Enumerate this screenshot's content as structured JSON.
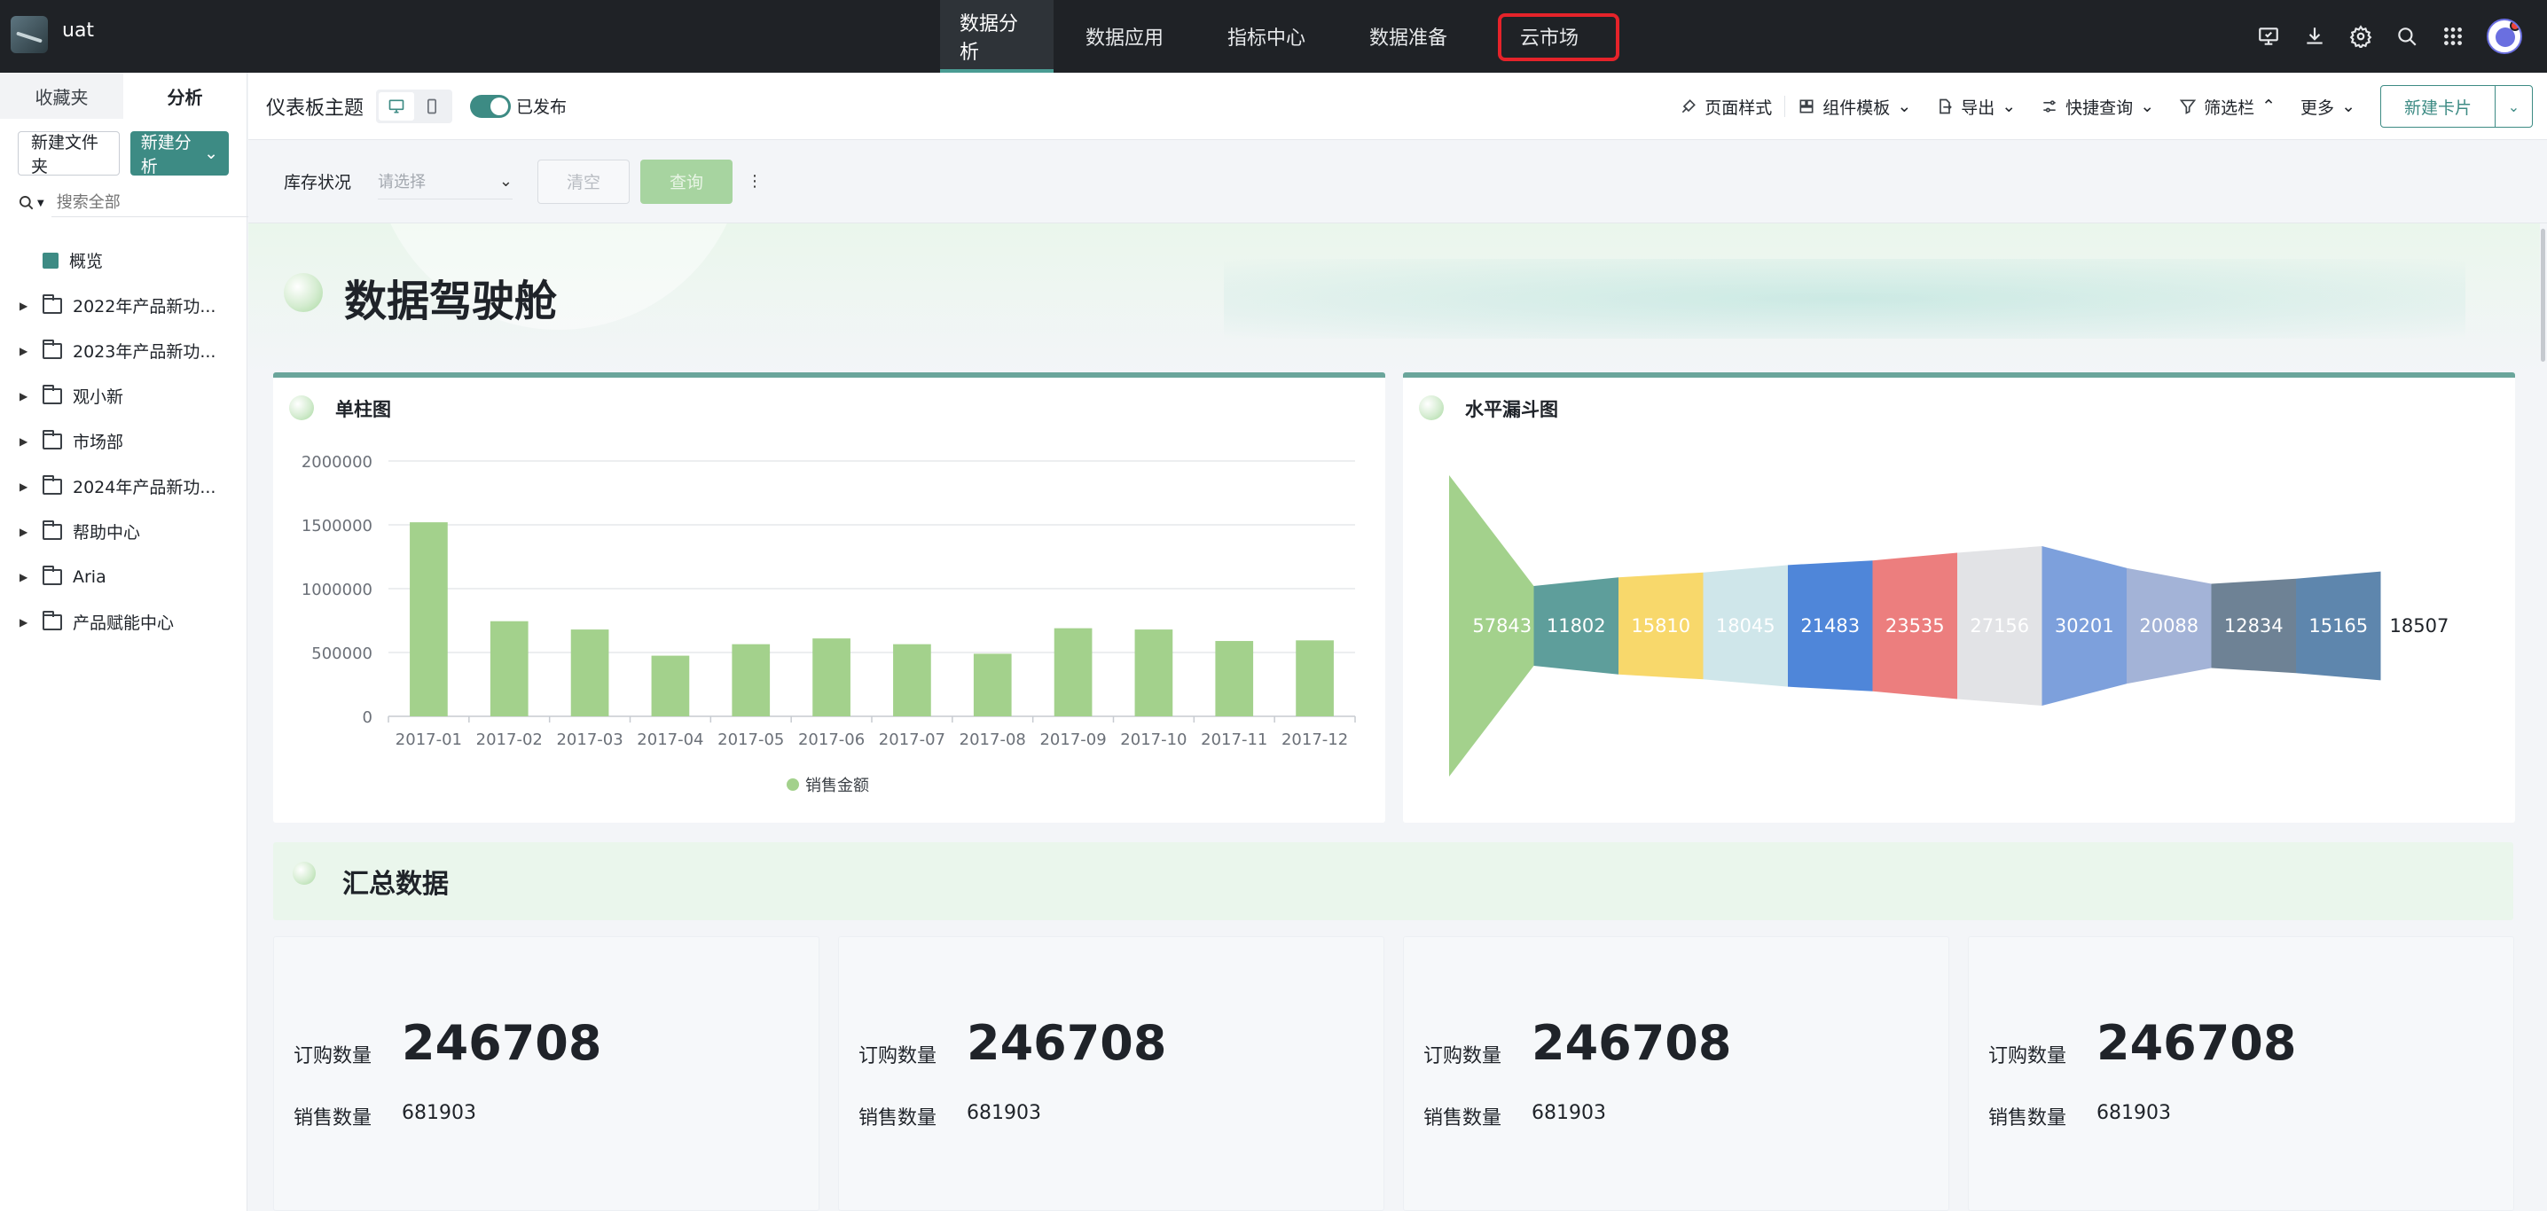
{
  "app": {
    "name": "uat"
  },
  "nav": {
    "items": [
      "数据分析",
      "数据应用",
      "指标中心",
      "数据准备",
      "云市场"
    ],
    "active_index": 0,
    "highlighted_index": 4
  },
  "top_icons": [
    "monitor-icon",
    "download-icon",
    "gear-icon",
    "search-icon",
    "apps-grid-icon",
    "avatar"
  ],
  "sidebar": {
    "tabs": [
      "收藏夹",
      "分析"
    ],
    "active_tab": 1,
    "new_folder_label": "新建文件夹",
    "new_analysis_label": "新建分析",
    "search_placeholder": "搜索全部",
    "items": [
      {
        "label": "概览",
        "type": "chart"
      },
      {
        "label": "2022年产品新功...",
        "type": "folder"
      },
      {
        "label": "2023年产品新功...",
        "type": "folder"
      },
      {
        "label": "观小新",
        "type": "folder"
      },
      {
        "label": "市场部",
        "type": "folder"
      },
      {
        "label": "2024年产品新功...",
        "type": "folder"
      },
      {
        "label": "帮助中心",
        "type": "folder"
      },
      {
        "label": "Aria",
        "type": "folder"
      },
      {
        "label": "产品赋能中心",
        "type": "folder"
      }
    ]
  },
  "toolbar": {
    "title": "仪表板主题",
    "published_label": "已发布",
    "actions": [
      "页面样式",
      "组件模板",
      "导出",
      "快捷查询",
      "筛选栏",
      "更多"
    ],
    "new_card_label": "新建卡片"
  },
  "filter": {
    "label": "库存状况",
    "select_placeholder": "请选择",
    "clear_label": "清空",
    "query_label": "查询"
  },
  "dashboard": {
    "title": "数据驾驶舱",
    "summary_title": "汇总数据"
  },
  "chart_data": [
    {
      "type": "bar",
      "title": "单柱图",
      "categories": [
        "2017-01",
        "2017-02",
        "2017-03",
        "2017-04",
        "2017-05",
        "2017-06",
        "2017-07",
        "2017-08",
        "2017-09",
        "2017-10",
        "2017-11",
        "2017-12"
      ],
      "series": [
        {
          "name": "销售金额",
          "values": [
            1520000,
            745000,
            680000,
            475000,
            565000,
            610000,
            565000,
            490000,
            690000,
            680000,
            590000,
            595000
          ]
        }
      ],
      "ylim": [
        0,
        2000000
      ],
      "yticks": [
        0,
        500000,
        1000000,
        1500000,
        2000000
      ],
      "color": "#a3d18c",
      "legend": "bottom-center"
    },
    {
      "type": "funnel",
      "title": "水平漏斗图",
      "orientation": "horizontal",
      "values": [
        57843,
        11802,
        15810,
        18045,
        21483,
        23535,
        27156,
        30201,
        20088,
        12834,
        15165,
        18507
      ],
      "colors": [
        "#a3d18c",
        "#5e9e9b",
        "#f8d86b",
        "#cfe6ea",
        "#4f86d9",
        "#ec7e7e",
        "#e2e3e6",
        "#7da0dc",
        "#a3b3d7",
        "#6e8295",
        "#5e86ad"
      ]
    }
  ],
  "kpis": [
    {
      "label": "订购数量",
      "value": "246708",
      "sub_label": "销售数量",
      "sub_value": "681903"
    },
    {
      "label": "订购数量",
      "value": "246708",
      "sub_label": "销售数量",
      "sub_value": "681903"
    },
    {
      "label": "订购数量",
      "value": "246708",
      "sub_label": "销售数量",
      "sub_value": "681903"
    },
    {
      "label": "订购数量",
      "value": "246708",
      "sub_label": "销售数量",
      "sub_value": "681903"
    }
  ]
}
